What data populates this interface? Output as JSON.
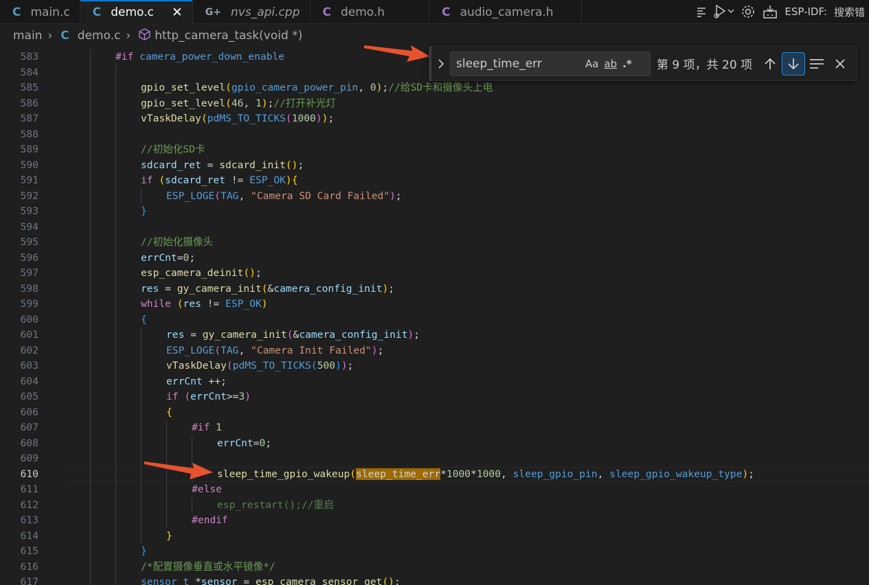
{
  "tabs": [
    {
      "icon": "C",
      "label": "main.c",
      "type": "c",
      "italic": false,
      "active": false
    },
    {
      "icon": "C",
      "label": "demo.c",
      "type": "c",
      "italic": false,
      "active": true
    },
    {
      "icon": "G+",
      "label": "nvs_api.cpp",
      "type": "cpp",
      "italic": true,
      "active": false
    },
    {
      "icon": "C",
      "label": "demo.h",
      "type": "h",
      "italic": false,
      "active": false
    },
    {
      "icon": "C",
      "label": "audio_camera.h",
      "type": "h",
      "italic": false,
      "active": false
    }
  ],
  "tab_close": "✕",
  "toolbar": {
    "esp_idf_label": "ESP-IDF:",
    "search_label": "搜索错"
  },
  "breadcrumb": {
    "folder": "main",
    "file_icon": "C",
    "file": "demo.c",
    "symbol": "http_camera_task(void *)"
  },
  "find": {
    "query": "sleep_time_err",
    "match_case": "Aa",
    "whole_word": "ab",
    "regex": ".*",
    "count": "第 9 项，共 20 项"
  },
  "icons": {
    "expand": "chevron-right-icon",
    "prev": "arrow-up-icon",
    "next": "arrow-down-icon",
    "selection": "find-in-selection-icon",
    "close": "close-icon"
  },
  "editor": {
    "current_line": 610,
    "first_line": 583,
    "line_numbers": [
      583,
      584,
      585,
      586,
      587,
      588,
      589,
      590,
      591,
      592,
      593,
      594,
      595,
      596,
      597,
      598,
      599,
      600,
      601,
      602,
      603,
      604,
      605,
      606,
      607,
      608,
      609,
      610,
      611,
      612,
      613,
      614,
      615,
      616,
      617
    ]
  },
  "colors": {
    "accent": "#0078d4",
    "match_highlight": "#9e6a03",
    "annotation_arrow": "#e8532f"
  }
}
